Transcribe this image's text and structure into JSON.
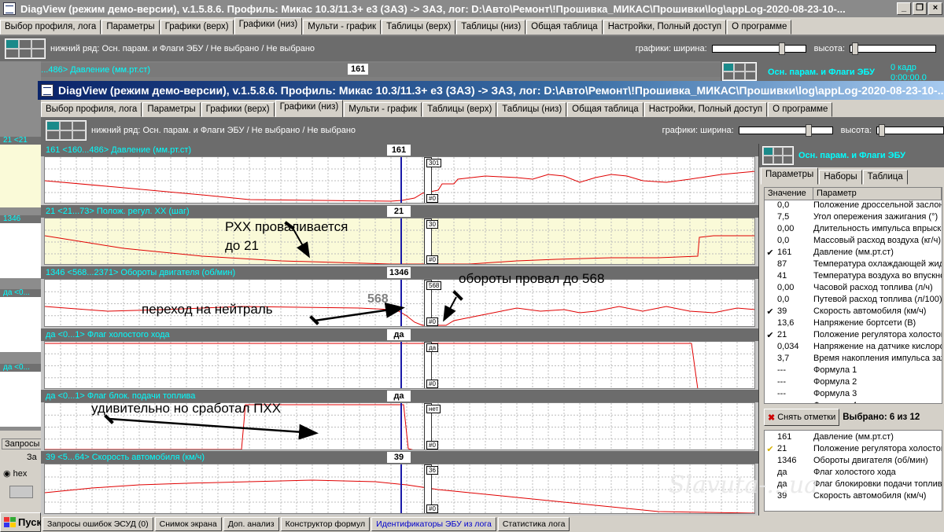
{
  "back_window": {
    "title": "DiagView (режим демо-версии), v.1.5.8.6. Профиль: Микас 10.3/11.3+ е3 (ЗАЗ) -> ЗАЗ,  лог: D:\\Авто\\Ремонт\\!Прошивка_МИКАС\\Прошивки\\log\\appLog-2020-08-23-10-...",
    "tabs": [
      "Выбор профиля, лога",
      "Параметры",
      "Графики (верх)",
      "Графики (низ)",
      "Мульти - график",
      "Таблицы (верх)",
      "Таблицы (низ)",
      "Общая таблица",
      "Настройки, Полный доступ",
      "О программе"
    ],
    "active_tab": 3,
    "bottom_row_label": "нижний ряд: Осн. парам. и Флаги ЭБУ / Не выбрано / Не выбрано",
    "graphs_width_label": "графики:  ширина:",
    "height_label": "высота:",
    "first_header": "161   <160...486>  Давление (мм.рт.ст)",
    "first_value": "161",
    "right_panel_title": "Осн. парам. и Флаги ЭБУ",
    "frame_label": "0 кадр",
    "time_label": "0:00:00.0",
    "left_labels": [
      "21   <21",
      "1346",
      "да   <0...",
      "да   <0..."
    ],
    "bottom_left": {
      "requests": "Запросы",
      "za": "За",
      "hex": "hex"
    },
    "start_label": "Пуск"
  },
  "window": {
    "title": "DiagView (режим демо-версии), v.1.5.8.6. Профиль: Микас 10.3/11.3+ е3 (ЗАЗ) -> ЗАЗ,   лог: D:\\Авто\\Ремонт\\!Прошивка_МИКАС\\Прошивки\\log\\appLog-2020-08-23-10-...",
    "tabs": [
      "Выбор профиля, лога",
      "Параметры",
      "Графики (верх)",
      "Графики (низ)",
      "Мульти - график",
      "Таблицы (верх)",
      "Таблицы (низ)",
      "Общая таблица",
      "Настройки, Полный доступ",
      "О программе"
    ],
    "active_tab": 3,
    "bottom_row_label": "нижний ряд: Осн. парам. и Флаги ЭБУ / Не выбрано / Не выбрано",
    "graphs_width_label": "графики:  ширина:",
    "height_label": "высота:"
  },
  "graphs": [
    {
      "header": "161   <160...486>  Давление (мм.рт.ст)",
      "value": "161",
      "scale_top": "301",
      "scale_bottom": "#0",
      "bg": "#ffffff"
    },
    {
      "header": "21   <21...73>  Полож. регул. ХХ (шаг)",
      "value": "21",
      "scale_top": "30",
      "scale_bottom": "#0",
      "bg": "#fafad8"
    },
    {
      "header": "1346   <568...2371>  Обороты двигателя (об/мин)",
      "value": "1346",
      "scale_top": "568",
      "scale_bottom": "#0",
      "bg": "#ffffff"
    },
    {
      "header": "да   <0...1>  Флаг холостого хода",
      "value": "да",
      "scale_top": "да",
      "scale_bottom": "#0",
      "bg": "#ffffff"
    },
    {
      "header": "да   <0...1>  Флаг блок. подачи топлива",
      "value": "да",
      "scale_top": "нет",
      "scale_bottom": "#0",
      "bg": "#ffffff"
    },
    {
      "header": "39   <5...64>  Скорость автомобиля (км/ч)",
      "value": "39",
      "scale_top": "36",
      "scale_bottom": "#0",
      "bg": "#ffffff"
    }
  ],
  "annotations": {
    "rxx_drop": "РХХ проваливается\nдо 21",
    "rpm_drop": "обороты провал до 568",
    "neutral": "переход на нейтраль",
    "gray_568": "568",
    "pxx": "удивительно но сработал ПХХ"
  },
  "right_panel": {
    "title": "Осн. парам. и Флаги ЭБУ",
    "tabs": [
      "Параметры",
      "Наборы",
      "Таблица"
    ],
    "active_tab": 0,
    "col_value": "Значение",
    "col_param": "Параметр",
    "rows": [
      {
        "checked": false,
        "value": "0,0",
        "name": "Положение дроссельной заслонки"
      },
      {
        "checked": false,
        "value": "7,5",
        "name": "Угол опережения зажигания (°)"
      },
      {
        "checked": false,
        "value": "0,00",
        "name": "Длительность импульса впрыска"
      },
      {
        "checked": false,
        "value": "0,0",
        "name": "Массовый расход воздуха (кг/ч)"
      },
      {
        "checked": true,
        "value": "161",
        "name": "Давление (мм.рт.ст)"
      },
      {
        "checked": false,
        "value": "87",
        "name": "Температура охлаждающей жидкости"
      },
      {
        "checked": false,
        "value": "41",
        "name": "Температура воздуха во впускном"
      },
      {
        "checked": false,
        "value": "0,00",
        "name": "Часовой расход топлива (л/ч)"
      },
      {
        "checked": false,
        "value": "0,0",
        "name": "Путевой расход топлива (л/100)"
      },
      {
        "checked": true,
        "value": "39",
        "name": "Скорость автомобиля (км/ч)"
      },
      {
        "checked": false,
        "value": "13,6",
        "name": "Напряжение бортсети (В)"
      },
      {
        "checked": true,
        "value": "21",
        "name": "Положение регулятора холостого"
      },
      {
        "checked": false,
        "value": "0,034",
        "name": "Напряжение на датчике кислорода"
      },
      {
        "checked": false,
        "value": "3,7",
        "name": "Время накопления импульса зажиг"
      },
      {
        "checked": false,
        "value": "---",
        "name": "Формула 1"
      },
      {
        "checked": false,
        "value": "---",
        "name": "Формула 2"
      },
      {
        "checked": false,
        "value": "---",
        "name": "Формула 3"
      },
      {
        "checked": false,
        "value": "---",
        "name": "Формула 4"
      }
    ],
    "clear_button": "Снять отметки",
    "selected_count": "Выбрано: 6 из 12",
    "selected": [
      {
        "value": "161",
        "name": "Давление (мм.рт.ст)"
      },
      {
        "value": "21",
        "name": "Положение регулятора холостого"
      },
      {
        "value": "1346",
        "name": "Обороты двигателя (об/мин)"
      },
      {
        "value": "да",
        "name": "Флаг холостого хода"
      },
      {
        "value": "да",
        "name": "Флаг блокировки подачи топлива"
      },
      {
        "value": "39",
        "name": "Скорость автомобиля (км/ч)"
      }
    ]
  },
  "status_buttons": [
    "Запросы ошибок ЭСУД (0)",
    "Снимок экрана",
    "Доп. анализ",
    "Конструктор формул",
    "Идентификаторы ЭБУ из лога",
    "Статистика лога"
  ],
  "watermark": "Slavuta-...ua",
  "colors": {
    "cursor": "#1a1aa8",
    "trace": "#e00000",
    "header_text": "#00ffff",
    "title_bar": "#0a246a"
  }
}
